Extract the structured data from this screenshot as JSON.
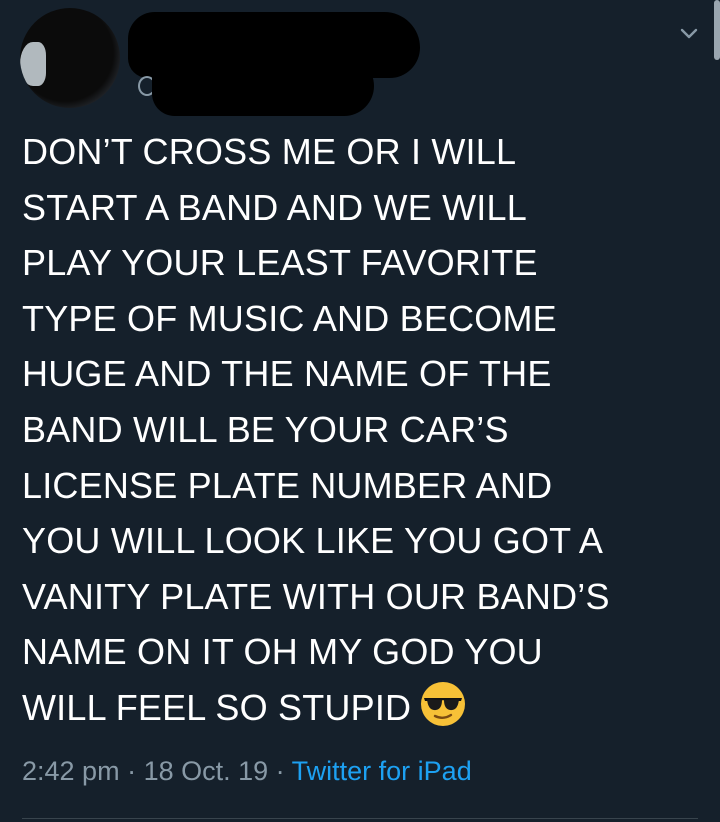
{
  "tweet": {
    "text": "DON’T CROSS ME OR I WILL\nSTART A BAND AND WE WILL\nPLAY YOUR LEAST FAVORITE\nTYPE OF MUSIC AND BECOME\nHUGE AND THE NAME OF THE\nBAND WILL BE YOUR CAR’S\nLICENSE PLATE NUMBER AND\nYOU WILL LOOK LIKE YOU GOT A\nVANITY PLATE WITH OUR BAND’S\nNAME ON IT OH MY GOD YOU\nWILL FEEL SO STUPID",
    "emoji": "smiling-face-with-sunglasses",
    "time": "2:42 pm",
    "separator": " · ",
    "date": "18 Oct. 19",
    "source": "Twitter for iPad"
  },
  "colors": {
    "background": "#15202b",
    "text": "#ffffff",
    "meta": "#8899a6",
    "link": "#1da1f2",
    "divider": "#38444d",
    "emoji": "#f7c137"
  },
  "icons": {
    "menu": "chevron-down-icon"
  }
}
